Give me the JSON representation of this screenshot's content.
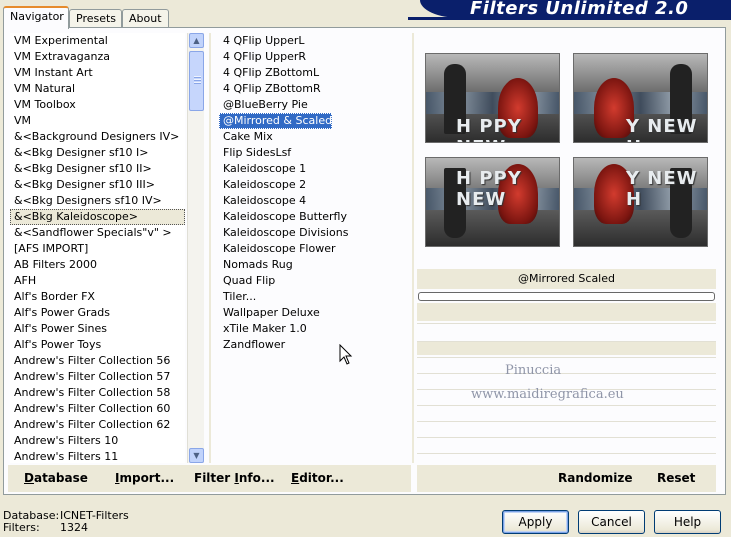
{
  "header": {
    "title": "Filters Unlimited 2.0"
  },
  "tabs": [
    {
      "label": "Navigator",
      "active": true
    },
    {
      "label": "Presets",
      "active": false
    },
    {
      "label": "About",
      "active": false
    }
  ],
  "categories": [
    "VM Experimental",
    "VM Extravaganza",
    "VM Instant Art",
    "VM Natural",
    "VM Toolbox",
    "VM",
    "&<Background Designers IV>",
    "&<Bkg Designer sf10 I>",
    "&<Bkg Designer sf10 II>",
    "&<Bkg Designer sf10 III>",
    "&<Bkg Designers sf10 IV>",
    "&<Bkg Kaleidoscope>",
    "&<Sandflower Specials\"v\" >",
    "[AFS IMPORT]",
    "AB Filters 2000",
    "AFH",
    "Alf's Border FX",
    "Alf's Power Grads",
    "Alf's Power Sines",
    "Alf's Power Toys",
    "Andrew's Filter Collection 56",
    "Andrew's Filter Collection 57",
    "Andrew's Filter Collection 58",
    "Andrew's Filter Collection 60",
    "Andrew's Filter Collection 62",
    "Andrew's Filters 10",
    "Andrew's Filters 11"
  ],
  "selected_category": "&<Bkg Kaleidoscope>",
  "filters": [
    "4 QFlip UpperL",
    "4 QFlip UpperR",
    "4 QFlip ZBottomL",
    "4 QFlip ZBottomR",
    "@BlueBerry Pie",
    "@Mirrored & Scaled",
    "Cake Mix",
    "Flip SidesLsf",
    "Kaleidoscope 1",
    "Kaleidoscope 2",
    "Kaleidoscope 4",
    "Kaleidoscope Butterfly",
    "Kaleidoscope Divisions",
    "Kaleidoscope Flower",
    "Nomads Rug",
    "Quad Flip",
    "Tiler...",
    "Wallpaper Deluxe",
    "xTile Maker 1.0",
    "Zandflower"
  ],
  "selected_filter": "@Mirrored & Scaled",
  "preview": {
    "filter_name": "@Mirrored  Scaled",
    "watermark_line1": "Pinuccia",
    "watermark_line2": "www.maidiregrafica.eu"
  },
  "toolbar_left": [
    {
      "label": "Database",
      "underline_index": 0
    },
    {
      "label": "Import...",
      "underline_index": 0
    },
    {
      "label": "Filter Info...",
      "underline_index": 7
    },
    {
      "label": "Editor...",
      "underline_index": 0
    }
  ],
  "toolbar_right": {
    "randomize": "Randomize",
    "reset": "Reset"
  },
  "status": {
    "database_label": "Database:",
    "database_value": "ICNET-Filters",
    "filters_label": "Filters:",
    "filters_value": "1324"
  },
  "buttons": {
    "apply": "Apply",
    "cancel": "Cancel",
    "help": "Help"
  },
  "colors": {
    "selection": "#316ac5",
    "banner": "#0a1f6b",
    "tab_highlight": "#e68b2c"
  }
}
